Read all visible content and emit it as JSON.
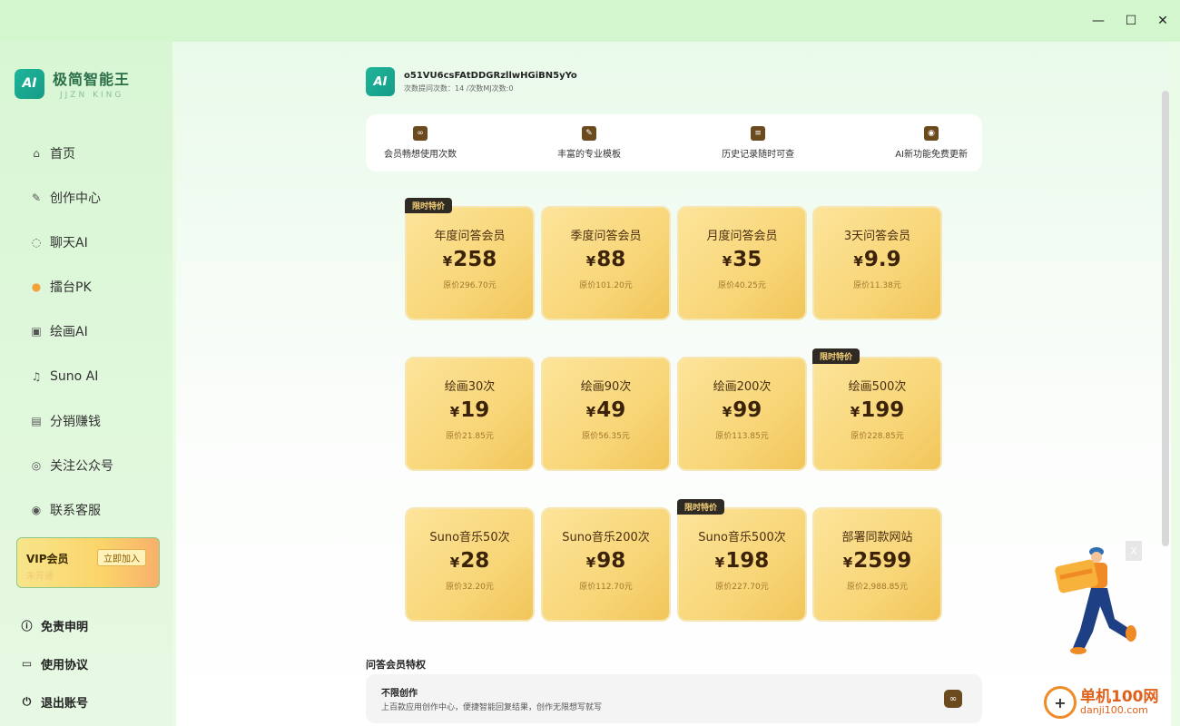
{
  "window": {
    "minimize_glyph": "—",
    "maximize_glyph": "☐",
    "close_glyph": "✕"
  },
  "brand": {
    "logo_glyph": "AI",
    "name": "极简智能王",
    "subtitle": "JJZN KING"
  },
  "sidebar": {
    "items": [
      {
        "label": "首页",
        "icon": "home-icon",
        "glyph": "⌂"
      },
      {
        "label": "创作中心",
        "icon": "edit-icon",
        "glyph": "✎"
      },
      {
        "label": "聊天AI",
        "icon": "chat-icon",
        "glyph": "◌"
      },
      {
        "label": "擂台PK",
        "icon": "pk-icon",
        "glyph": "●"
      },
      {
        "label": "绘画AI",
        "icon": "image-icon",
        "glyph": "▣"
      },
      {
        "label": "Suno AI",
        "icon": "music-icon",
        "glyph": "♫"
      },
      {
        "label": "分销赚钱",
        "icon": "gift-icon",
        "glyph": "▤"
      },
      {
        "label": "关注公众号",
        "icon": "wechat-icon",
        "glyph": "◎"
      },
      {
        "label": "联系客服",
        "icon": "location-icon",
        "glyph": "◉"
      }
    ],
    "vip": {
      "label": "VIP会员",
      "status": "未开通",
      "join_label": "立即加入"
    },
    "bottom": [
      {
        "label": "免责申明",
        "icon": "info-icon",
        "glyph": "ⓘ"
      },
      {
        "label": "使用协议",
        "icon": "document-icon",
        "glyph": "▭"
      },
      {
        "label": "退出账号",
        "icon": "power-icon",
        "glyph": "⏻"
      }
    ]
  },
  "user": {
    "avatar_glyph": "AI",
    "id": "o51VU6csFAtDDGRzllwHGiBN5yYo",
    "usage": "次数提问次数：14 /次数MJ次数:0"
  },
  "features": [
    {
      "label": "会员畅想使用次数",
      "icon": "infinity-icon",
      "glyph": "∞"
    },
    {
      "label": "丰富的专业模板",
      "icon": "template-icon",
      "glyph": "✎"
    },
    {
      "label": "历史记录随时可查",
      "icon": "history-icon",
      "glyph": "≡"
    },
    {
      "label": "AI新功能免费更新",
      "icon": "update-icon",
      "glyph": "◉"
    }
  ],
  "badge_text": "限时特价",
  "plans": [
    {
      "name": "年度问答会员",
      "price": "258",
      "original": "原价296.70元",
      "badge": true
    },
    {
      "name": "季度问答会员",
      "price": "88",
      "original": "原价101.20元",
      "badge": false
    },
    {
      "name": "月度问答会员",
      "price": "35",
      "original": "原价40.25元",
      "badge": false
    },
    {
      "name": "3天问答会员",
      "price": "9.9",
      "original": "原价11.38元",
      "badge": false
    },
    {
      "name": "绘画30次",
      "price": "19",
      "original": "原价21.85元",
      "badge": false
    },
    {
      "name": "绘画90次",
      "price": "49",
      "original": "原价56.35元",
      "badge": false
    },
    {
      "name": "绘画200次",
      "price": "99",
      "original": "原价113.85元",
      "badge": false
    },
    {
      "name": "绘画500次",
      "price": "199",
      "original": "原价228.85元",
      "badge": true
    },
    {
      "name": "Suno音乐50次",
      "price": "28",
      "original": "原价32.20元",
      "badge": false
    },
    {
      "name": "Suno音乐200次",
      "price": "98",
      "original": "原价112.70元",
      "badge": false
    },
    {
      "name": "Suno音乐500次",
      "price": "198",
      "original": "原价227.70元",
      "badge": true
    },
    {
      "name": "部署同款网站",
      "price": "2599",
      "original": "原价2,988.85元",
      "badge": false
    }
  ],
  "currency_symbol": "¥",
  "privileges": {
    "title": "问答会员特权",
    "items": [
      {
        "title": "不限创作",
        "desc": "上百款应用创作中心，便捷智能回复结果，创作无限想写就写",
        "glyph": "∞"
      }
    ]
  },
  "promo": {
    "close_label": "X"
  },
  "watermark": {
    "logo_glyph": "+",
    "cn": "单机100网",
    "en": "danji100.com"
  }
}
